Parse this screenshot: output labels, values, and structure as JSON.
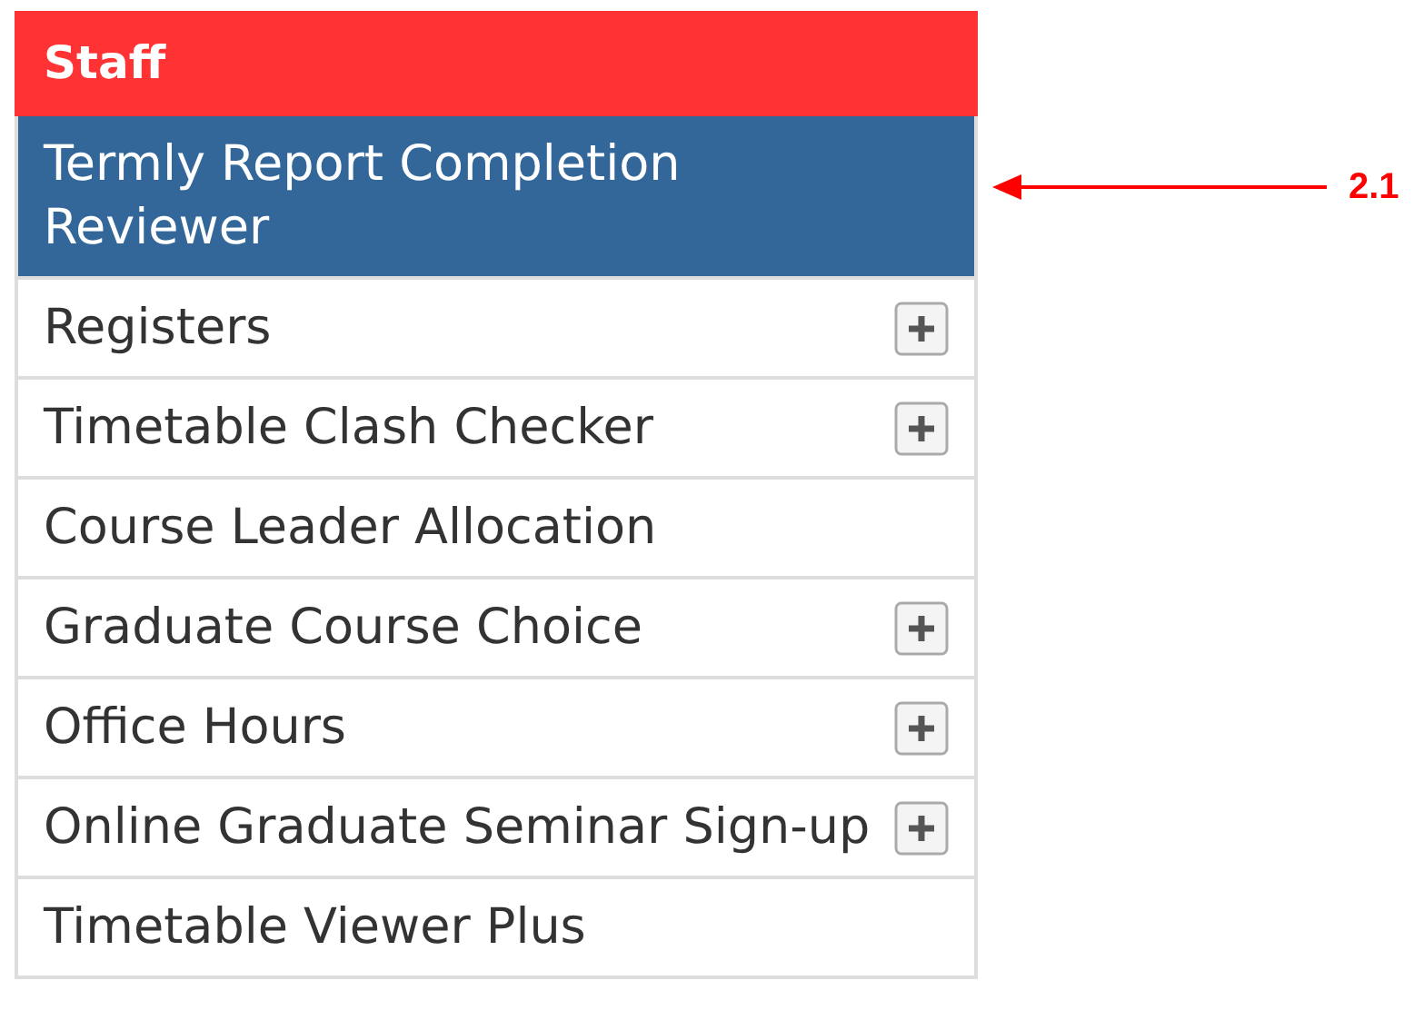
{
  "menu": {
    "title": "Staff",
    "items": [
      {
        "label": "Termly Report Completion Reviewer",
        "selected": true,
        "expandable": false
      },
      {
        "label": "Registers",
        "selected": false,
        "expandable": true
      },
      {
        "label": "Timetable Clash Checker",
        "selected": false,
        "expandable": true
      },
      {
        "label": "Course Leader Allocation",
        "selected": false,
        "expandable": false
      },
      {
        "label": "Graduate Course Choice",
        "selected": false,
        "expandable": true
      },
      {
        "label": "Office Hours",
        "selected": false,
        "expandable": true
      },
      {
        "label": "Online Graduate Seminar Sign-up",
        "selected": false,
        "expandable": true
      },
      {
        "label": "Timetable Viewer Plus",
        "selected": false,
        "expandable": false
      }
    ]
  },
  "annotation": {
    "label": "2.1"
  }
}
